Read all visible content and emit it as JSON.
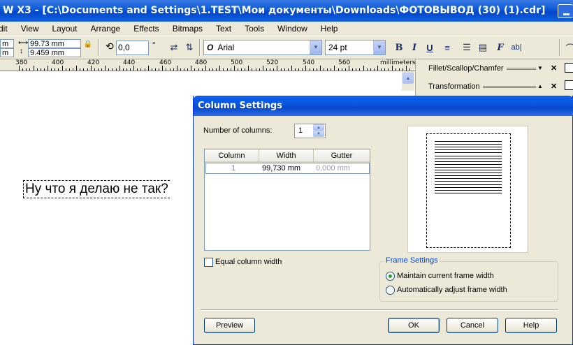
{
  "app": {
    "title": "W X3 - [C:\\Documents and Settings\\1.TEST\\Мои документы\\Downloads\\ФОТОВЫВОД (30) (1).cdr]"
  },
  "menu": [
    "dit",
    "View",
    "Layout",
    "Arrange",
    "Effects",
    "Bitmaps",
    "Text",
    "Tools",
    "Window",
    "Help"
  ],
  "propbar": {
    "pos_x": "m",
    "pos_y": "m",
    "width": "99.73 mm",
    "height": "9.459 mm",
    "angle": "0,0",
    "angle_unit": "°",
    "font_name": "Arial",
    "font_size": "24 pt",
    "font_icon_glyph": "O",
    "bold": "B",
    "italic": "I",
    "underline": "U",
    "format_glyph": "F",
    "ab_glyph": "ab|"
  },
  "ruler": {
    "labels": [
      "380",
      "400",
      "420",
      "440",
      "460",
      "480",
      "500",
      "520",
      "540",
      "560"
    ],
    "unit": "millimeters"
  },
  "docker": {
    "items": [
      "Fillet/Scallop/Chamfer",
      "Transformation"
    ],
    "close_glyph": "✕"
  },
  "canvas": {
    "text": "Ну что я делаю не так?"
  },
  "dialog": {
    "title": "Column Settings",
    "num_columns_label": "Number of columns:",
    "num_columns_value": "1",
    "table_headers": [
      "Column",
      "Width",
      "Gutter"
    ],
    "table_rows": [
      {
        "column": "1",
        "width": "99,730 mm",
        "gutter": "0,000 mm"
      }
    ],
    "equal_width_label": "Equal column width",
    "equal_width_checked": false,
    "frame_settings_title": "Frame Settings",
    "radio_maintain": "Maintain current frame width",
    "radio_auto": "Automatically adjust frame width",
    "selected_radio": "maintain",
    "preview_button": "Preview",
    "ok_button": "OK",
    "cancel_button": "Cancel",
    "help_button": "Help"
  }
}
